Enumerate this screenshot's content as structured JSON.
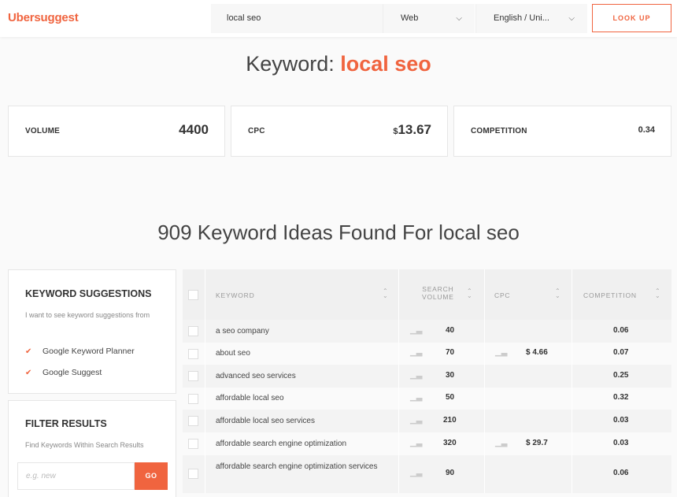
{
  "header": {
    "logo": "Ubersuggest",
    "search_value": "local seo",
    "platform": "Web",
    "language": "English / Uni...",
    "lookup_label": "LOOK UP"
  },
  "title": {
    "prefix": "Keyword: ",
    "keyword": "local seo"
  },
  "metrics": {
    "volume": {
      "label": "VOLUME",
      "value": "4400"
    },
    "cpc": {
      "label": "CPC",
      "currency": "$",
      "value": "13.67"
    },
    "competition": {
      "label": "COMPETITION",
      "value": "0.34"
    }
  },
  "ideas_title": "909 Keyword Ideas Found For local seo",
  "suggestions": {
    "title": "KEYWORD SUGGESTIONS",
    "desc": "I want to see keyword suggestions from",
    "options": [
      "Google Keyword Planner",
      "Google Suggest"
    ]
  },
  "filter": {
    "title": "FILTER RESULTS",
    "desc": "Find Keywords Within Search Results",
    "placeholder": "e.g. new",
    "go_label": "GO"
  },
  "table": {
    "headers": {
      "keyword": "KEYWORD",
      "volume_line1": "SEARCH",
      "volume_line2": "VOLUME",
      "cpc": "CPC",
      "competition": "COMPETITION"
    },
    "rows": [
      {
        "keyword": "a seo company",
        "volume": "40",
        "cpc": "",
        "competition": "0.06"
      },
      {
        "keyword": "about seo",
        "volume": "70",
        "cpc": "$ 4.66",
        "competition": "0.07"
      },
      {
        "keyword": "advanced seo services",
        "volume": "30",
        "cpc": "",
        "competition": "0.25"
      },
      {
        "keyword": "affordable local seo",
        "volume": "50",
        "cpc": "",
        "competition": "0.32"
      },
      {
        "keyword": "affordable local seo services",
        "volume": "210",
        "cpc": "",
        "competition": "0.03"
      },
      {
        "keyword": "affordable search engine optimization",
        "volume": "320",
        "cpc": "$ 29.7",
        "competition": "0.03"
      },
      {
        "keyword": "affordable search engine optimization services",
        "volume": "90",
        "cpc": "",
        "competition": "0.06"
      }
    ]
  },
  "colors": {
    "accent": "#f0643f"
  },
  "icons": {
    "checkbox_checked": "check-icon",
    "bar": "bar-chart-icon",
    "sort": "sort-icon",
    "dropdown": "chevron-down-icon"
  }
}
